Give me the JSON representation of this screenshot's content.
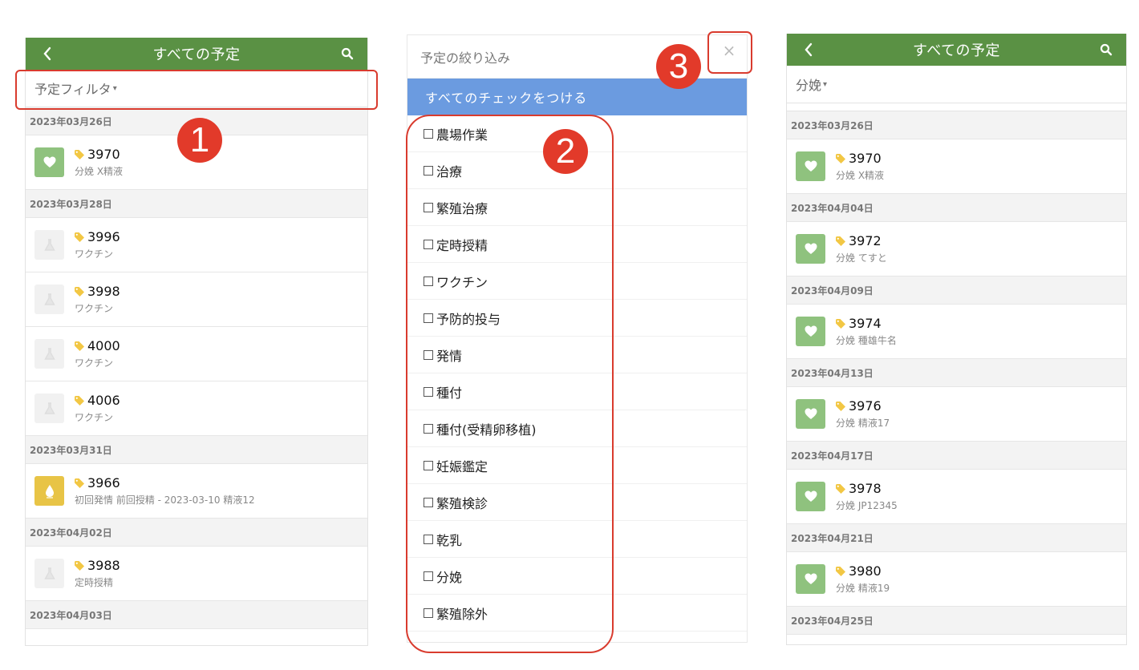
{
  "left_panel": {
    "title": "すべての予定",
    "filter_label": "予定フィルタ",
    "filter_caret": "▾",
    "groups": [
      {
        "date": "2023年03月26日",
        "items": [
          {
            "id": "3970",
            "sub": "分娩 X精液",
            "type": "green"
          }
        ]
      },
      {
        "date": "2023年03月28日",
        "items": [
          {
            "id": "3996",
            "sub": "ワクチン",
            "type": "gray"
          },
          {
            "id": "3998",
            "sub": "ワクチン",
            "type": "gray"
          },
          {
            "id": "4000",
            "sub": "ワクチン",
            "type": "gray"
          },
          {
            "id": "4006",
            "sub": "ワクチン",
            "type": "gray"
          }
        ]
      },
      {
        "date": "2023年03月31日",
        "items": [
          {
            "id": "3966",
            "sub": "初回発情 前回授精 - 2023-03-10 精液12",
            "type": "yellow"
          }
        ]
      },
      {
        "date": "2023年04月02日",
        "items": [
          {
            "id": "3988",
            "sub": "定時授精",
            "type": "gray"
          }
        ]
      },
      {
        "date": "2023年04月03日",
        "items": []
      }
    ]
  },
  "middle_panel": {
    "title": "予定の絞り込み",
    "check_all": "すべてのチェックをつける",
    "options": [
      "農場作業",
      "治療",
      "繁殖治療",
      "定時授精",
      "ワクチン",
      "予防的投与",
      "発情",
      "種付",
      "種付(受精卵移植)",
      "妊娠鑑定",
      "繁殖検診",
      "乾乳",
      "分娩",
      "繁殖除外"
    ],
    "close_symbol": "×"
  },
  "right_panel": {
    "title": "すべての予定",
    "filter_label": "分娩",
    "filter_caret": "▾",
    "groups": [
      {
        "date": "2023年03月26日",
        "items": [
          {
            "id": "3970",
            "sub": "分娩 X精液",
            "type": "green"
          }
        ]
      },
      {
        "date": "2023年04月04日",
        "items": [
          {
            "id": "3972",
            "sub": "分娩 てすと",
            "type": "green"
          }
        ]
      },
      {
        "date": "2023年04月09日",
        "items": [
          {
            "id": "3974",
            "sub": "分娩 種雄牛名",
            "type": "green"
          }
        ]
      },
      {
        "date": "2023年04月13日",
        "items": [
          {
            "id": "3976",
            "sub": "分娩 精液17",
            "type": "green"
          }
        ]
      },
      {
        "date": "2023年04月17日",
        "items": [
          {
            "id": "3978",
            "sub": "分娩 JP12345",
            "type": "green"
          }
        ]
      },
      {
        "date": "2023年04月21日",
        "items": [
          {
            "id": "3980",
            "sub": "分娩 精液19",
            "type": "green"
          }
        ]
      },
      {
        "date": "2023年04月25日",
        "items": []
      }
    ]
  },
  "annotations": {
    "m1": "1",
    "m2": "2",
    "m3": "3"
  },
  "colors": {
    "appbar": "#5a9144",
    "check_all": "#6b9be0",
    "highlight": "#d93b2e",
    "badge_green": "#8fc27e",
    "badge_yellow": "#e8c446"
  }
}
